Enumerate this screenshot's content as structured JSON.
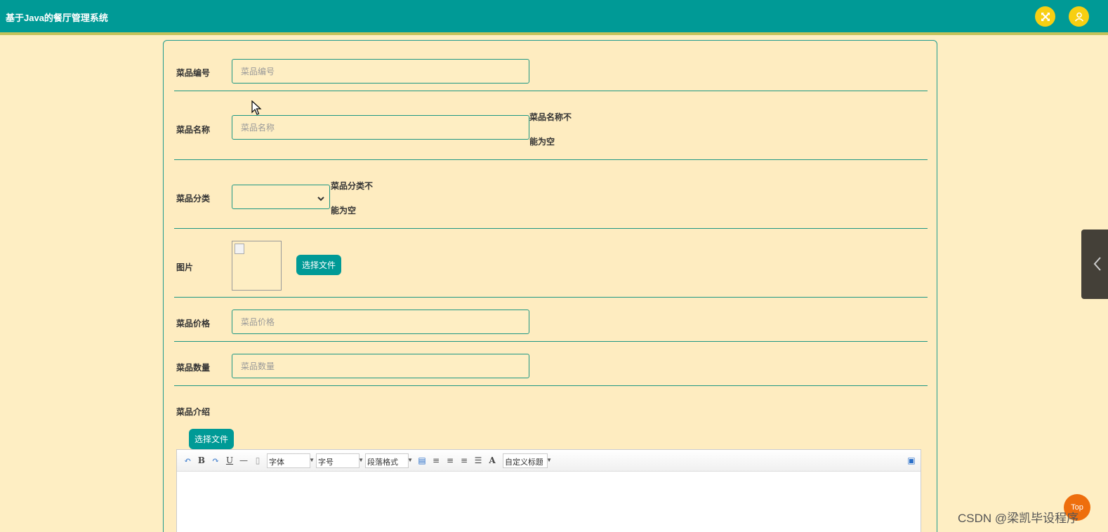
{
  "app": {
    "title": "基于Java的餐厅管理系统"
  },
  "header": {
    "icons": [
      "fullscreen-icon",
      "user-icon"
    ]
  },
  "form": {
    "dish_code": {
      "label": "菜品编号",
      "placeholder": "菜品编号",
      "value": ""
    },
    "dish_name": {
      "label": "菜品名称",
      "placeholder": "菜品名称",
      "value": "",
      "hint_line1": "菜品名称不",
      "hint_line2": "能为空"
    },
    "dish_category": {
      "label": "菜品分类",
      "selected": "",
      "hint_line1": "菜品分类不",
      "hint_line2": "能为空"
    },
    "image": {
      "label": "图片",
      "choose_button": "选择文件"
    },
    "dish_price": {
      "label": "菜品价格",
      "placeholder": "菜品价格",
      "value": ""
    },
    "dish_quantity": {
      "label": "菜品数量",
      "placeholder": "菜品数量",
      "value": ""
    },
    "dish_intro": {
      "label": "菜品介绍",
      "choose_button": "选择文件"
    }
  },
  "editor": {
    "font_select": "字体",
    "size_select": "字号",
    "paragraph_select": "段落格式",
    "custom_title_select": "自定义标题",
    "font_color_glyph": "A",
    "bold_glyph": "B",
    "underline_glyph": "U"
  },
  "floating": {
    "top_button": "Top"
  },
  "watermark": "CSDN @梁凯毕设程序",
  "colors": {
    "header": "#009a96",
    "page_bg": "#feeec3",
    "accent": "#1d9683",
    "icon_yellow": "#f8cf12",
    "top_button": "#ee6e0d"
  }
}
